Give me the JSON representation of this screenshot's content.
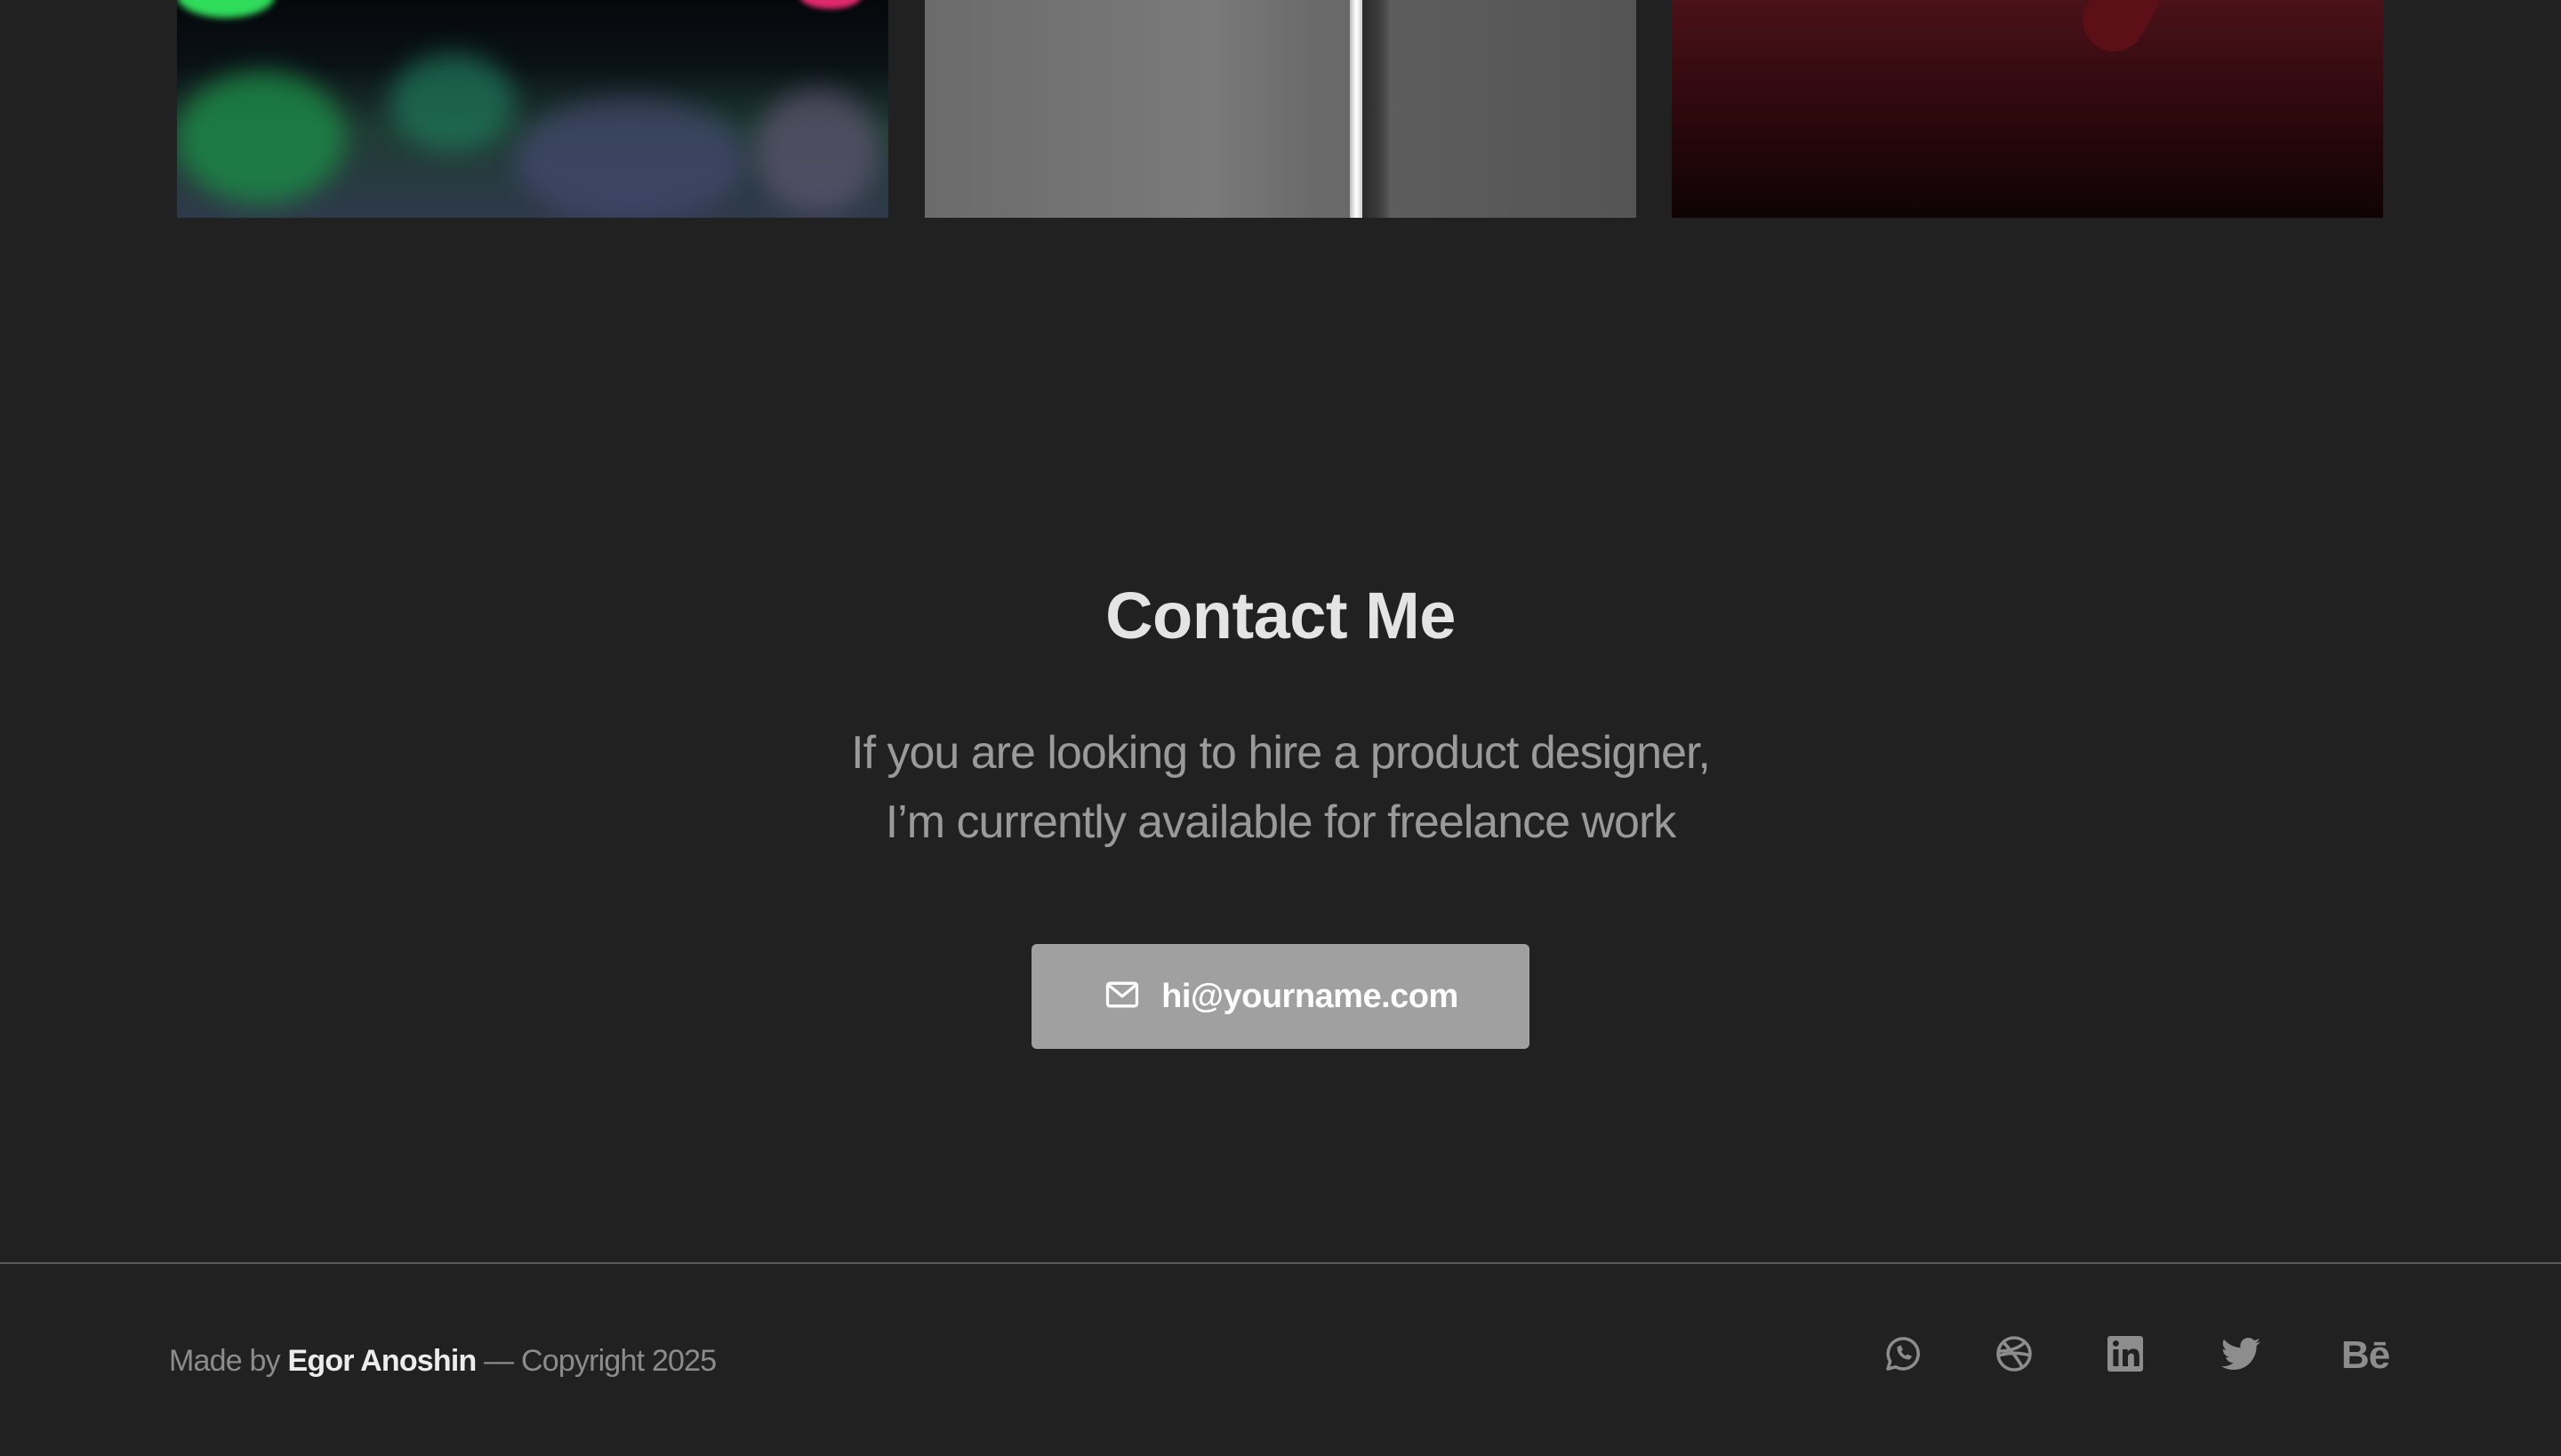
{
  "gallery": {
    "tiles": [
      {
        "name": "project-thumbnail-neon"
      },
      {
        "name": "project-thumbnail-gray"
      },
      {
        "name": "project-thumbnail-red"
      }
    ]
  },
  "contact": {
    "title": "Contact Me",
    "text_line_1": "If you are looking to hire a product designer,",
    "text_line_2": "I’m currently available for freelance work",
    "email_button_label": "hi@yourname.com",
    "email_icon": "mail-icon"
  },
  "footer": {
    "made_by_prefix": "Made by",
    "author": "Egor Anoshin",
    "copyright_suffix": "— Copyright 2025",
    "social_icons": [
      "whatsapp-icon",
      "dribbble-icon",
      "linkedin-icon",
      "twitter-icon",
      "behance-icon"
    ],
    "behance_label": "Bē"
  },
  "colors": {
    "background": "#212121",
    "heading": "#e4e4e4",
    "body_text": "#9a9a9a",
    "button_bg": "#a0a0a0",
    "icon": "#8d8d8d"
  }
}
